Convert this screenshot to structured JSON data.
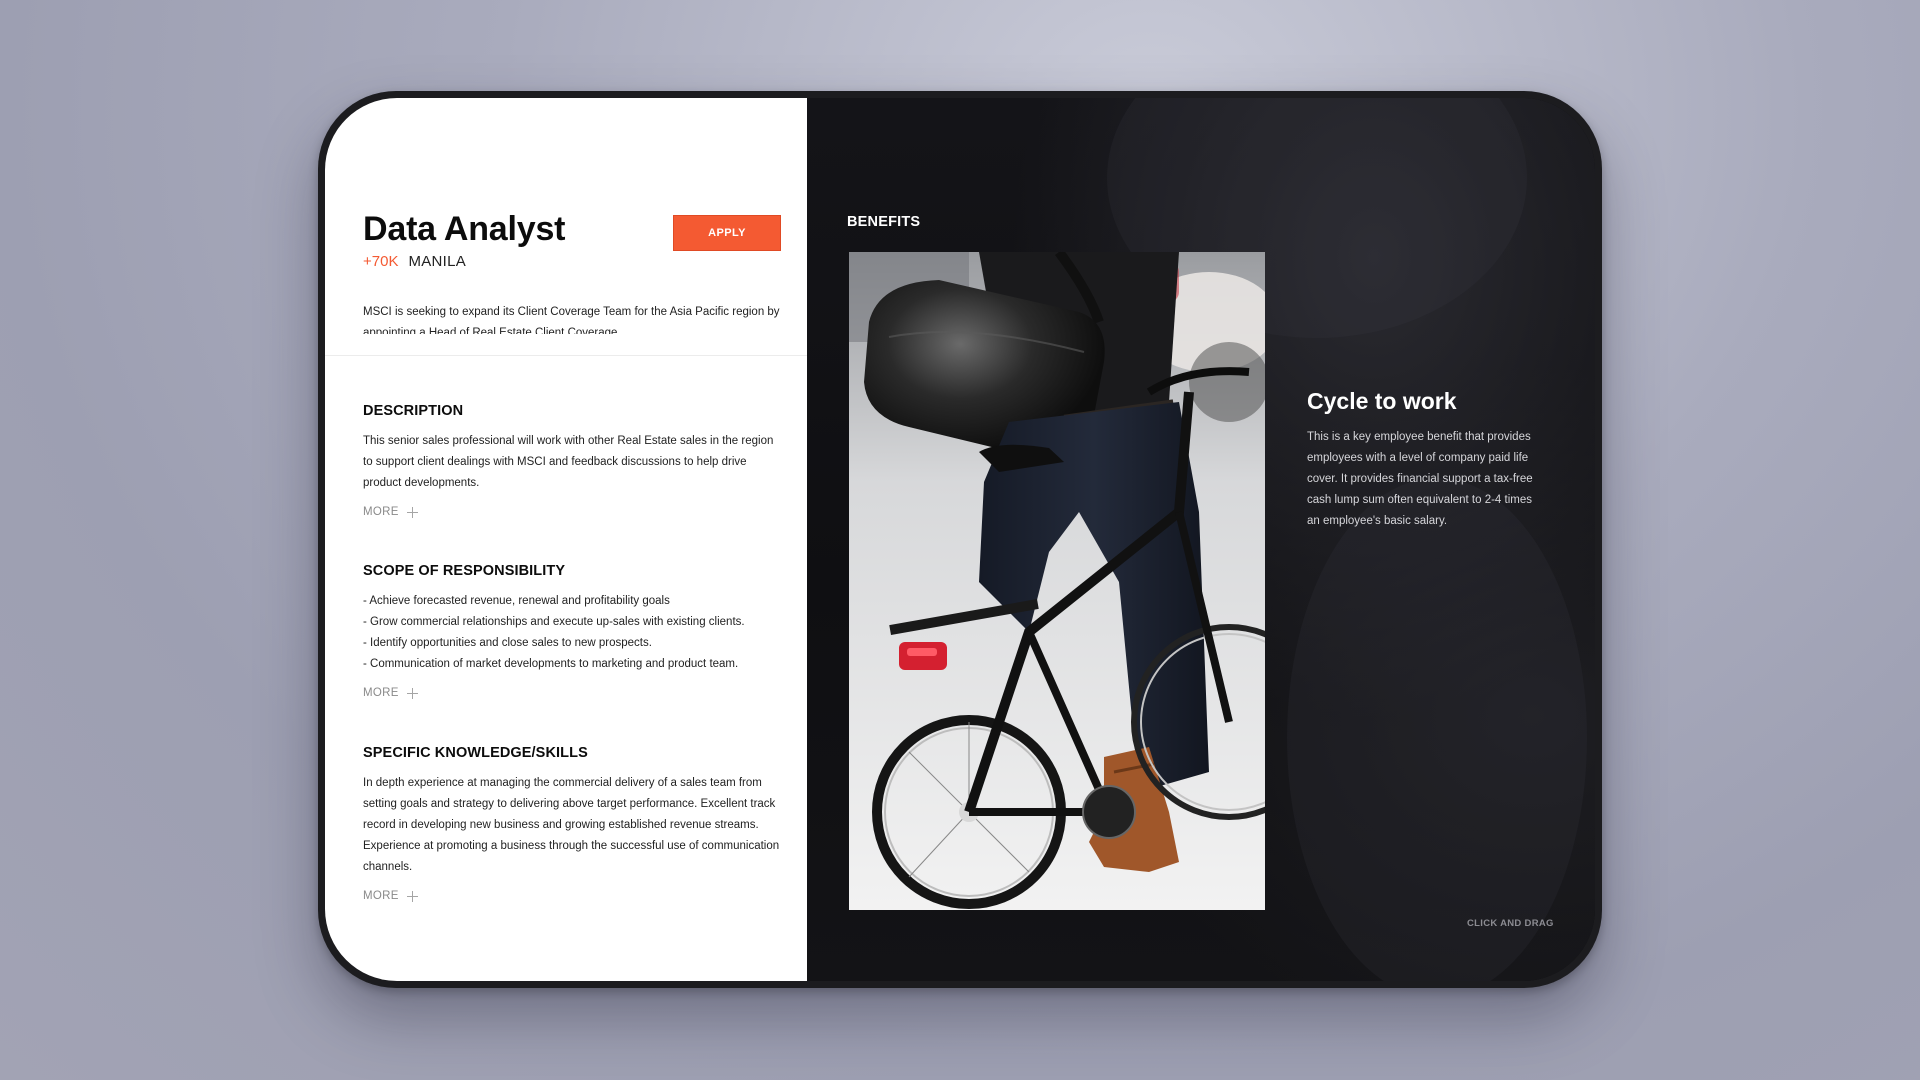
{
  "job": {
    "title": "Data Analyst",
    "salary": "+70K",
    "location": "MANILA",
    "apply_label": "APPLY",
    "intro": "MSCI is seeking to expand its Client Coverage Team for the Asia Pacific region by appointing a Head of Real Estate Client Coverage."
  },
  "sections": {
    "description": {
      "heading": "DESCRIPTION",
      "text": "This senior sales professional will work with other Real Estate sales in the region to support client dealings with MSCI and feedback discussions to help drive product developments.",
      "more_label": "MORE"
    },
    "scope": {
      "heading": "SCOPE OF RESPONSIBILITY",
      "items": [
        "- Achieve forecasted revenue, renewal and profitability goals",
        "- Grow commercial relationships and execute up-sales with existing clients.",
        "-  Identify opportunities and close sales to new prospects.",
        "- Communication of market developments to marketing and product team."
      ],
      "more_label": "MORE"
    },
    "skills": {
      "heading": "SPECIFIC KNOWLEDGE/SKILLS",
      "text": "In depth experience at managing the commercial delivery of a sales team from setting goals and strategy to delivering above target performance. Excellent track record in developing new business and growing established revenue streams. Experience at promoting a business through the successful use of communication channels.",
      "more_label": "MORE"
    }
  },
  "benefits": {
    "label": "BENEFITS",
    "title": "Cycle to work",
    "text": "This is a key employee benefit that provides employees with a level of company paid life cover. It provides financial support  a tax-free cash lump sum often equivalent to 2-4 times an employee's basic salary.",
    "drag_hint": "CLICK AND DRAG"
  },
  "colors": {
    "accent": "#f45a32",
    "panel_dark": "#0f0f12",
    "panel_light": "#ffffff"
  },
  "icons": {
    "more": "plus-icon"
  }
}
